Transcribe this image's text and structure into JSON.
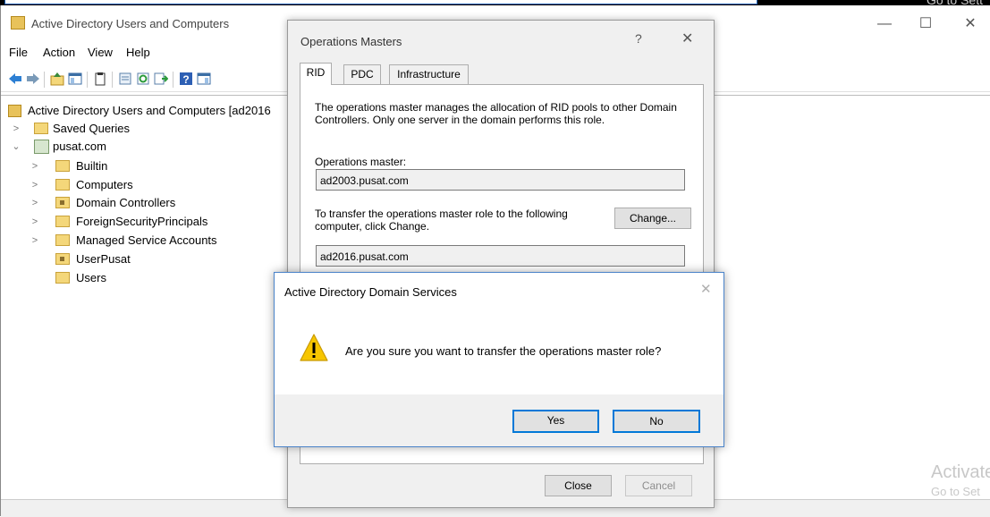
{
  "background_watermark_top": "Go to Sett",
  "main_window": {
    "title": "Active Directory Users and Computers",
    "menu": [
      "File",
      "Action",
      "View",
      "Help"
    ],
    "tree": {
      "root": "Active Directory Users and Computers [ad2016",
      "saved_queries": "Saved Queries",
      "domain": "pusat.com",
      "children": [
        "Builtin",
        "Computers",
        "Domain Controllers",
        "ForeignSecurityPrincipals",
        "Managed Service Accounts",
        "UserPusat",
        "Users"
      ]
    },
    "watermark": "Activate",
    "watermark_line2": "Go to Set"
  },
  "ops_dialog": {
    "title": "Operations Masters",
    "help": "?",
    "close": "✕",
    "tabs": [
      "RID",
      "PDC",
      "Infrastructure"
    ],
    "active_tab": "RID",
    "description": "The operations master manages the allocation of RID pools to other Domain Controllers. Only one server in the domain performs this role.",
    "master_label": "Operations master:",
    "master_value": "ad2003.pusat.com",
    "transfer_text": "To transfer the operations master role to the following computer, click Change.",
    "change_button": "Change...",
    "target_value": "ad2016.pusat.com",
    "close_button": "Close",
    "cancel_button": "Cancel"
  },
  "confirm_dialog": {
    "title": "Active Directory Domain Services",
    "close": "✕",
    "message": "Are you sure you want to transfer the operations master role?",
    "yes_button": "Yes",
    "no_button": "No"
  },
  "icons": {
    "warning": "warning-icon",
    "folder": "folder-icon",
    "domain": "domain-icon"
  },
  "colors": {
    "accent": "#0078d7",
    "warning": "#f7c600"
  }
}
